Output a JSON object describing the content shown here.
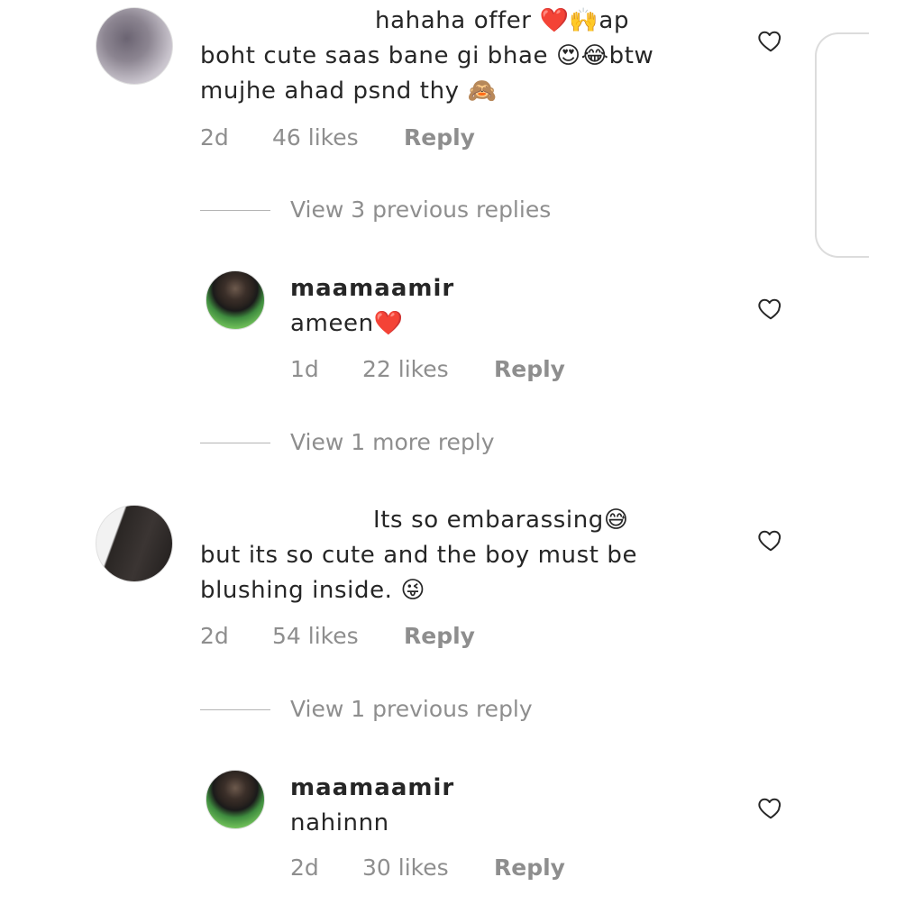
{
  "comments": [
    {
      "lines": [
        "hahaha offer ❤️🙌ap",
        "boht cute saas bane gi bhae 😍😂btw",
        "mujhe ahad psnd thy 🙈"
      ],
      "time": "2d",
      "likes": "46 likes",
      "reply": "Reply",
      "view_replies": "View 3 previous replies"
    },
    {
      "username": "maamaamir",
      "text": "ameen❤️",
      "time": "1d",
      "likes": "22 likes",
      "reply": "Reply",
      "view_replies": "View 1 more reply"
    },
    {
      "lines": [
        "Its so embarassing😅",
        "but its so cute and the boy must be",
        "blushing inside. 😜"
      ],
      "time": "2d",
      "likes": "54 likes",
      "reply": "Reply",
      "view_replies": "View 1 previous reply"
    },
    {
      "username": "maamaamir",
      "text": "nahinnn",
      "time": "2d",
      "likes": "30 likes",
      "reply": "Reply"
    }
  ],
  "icons": {
    "like": "heart-outline-icon"
  },
  "colors": {
    "text": "#262626",
    "meta": "#8e8e8e",
    "heart_stroke": "#262626"
  }
}
